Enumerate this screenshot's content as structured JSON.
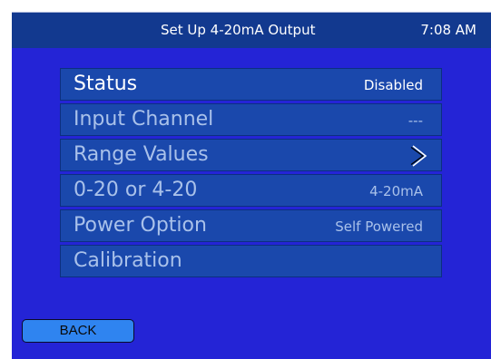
{
  "header": {
    "title": "Set Up 4-20mA Output",
    "time": "7:08 AM"
  },
  "menu": {
    "items": [
      {
        "label": "Status",
        "value": "Disabled",
        "active": true
      },
      {
        "label": "Input Channel",
        "value": "---"
      },
      {
        "label": "Range Values",
        "value": "",
        "icon": "chevron-right-icon"
      },
      {
        "label": "0-20 or 4-20",
        "value": "4-20mA"
      },
      {
        "label": "Power Option",
        "value": "Self Powered"
      },
      {
        "label": "Calibration",
        "value": ""
      }
    ]
  },
  "footer": {
    "back_label": "BACK"
  },
  "colors": {
    "panel_bg": "#2424d6",
    "header_bg": "#12398f",
    "item_bg": "#1a48ac",
    "item_text": "#a9c1ea",
    "active_text": "#ffffff",
    "button_bg": "#2f84f0"
  }
}
